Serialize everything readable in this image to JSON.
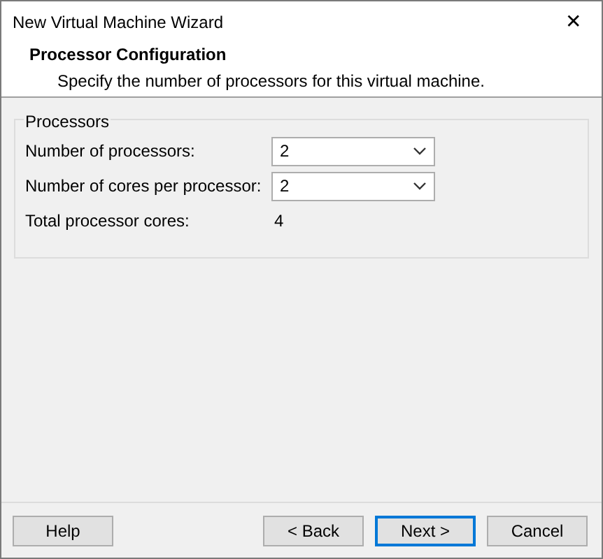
{
  "window": {
    "title": "New Virtual Machine Wizard",
    "close": "✕"
  },
  "header": {
    "title": "Processor Configuration",
    "subtitle": "Specify the number of processors for this virtual machine."
  },
  "group": {
    "label": "Processors",
    "rows": [
      {
        "kind": "select",
        "label": "Number of processors:",
        "value": "2"
      },
      {
        "kind": "select",
        "label": "Number of cores per processor:",
        "value": "2"
      },
      {
        "kind": "text",
        "label": "Total processor cores:",
        "value": "4"
      }
    ]
  },
  "buttons": [
    {
      "label": "Help",
      "focused": false
    },
    {
      "label": "< Back",
      "focused": false
    },
    {
      "label": "Next >",
      "focused": true
    },
    {
      "label": "Cancel",
      "focused": false
    }
  ]
}
